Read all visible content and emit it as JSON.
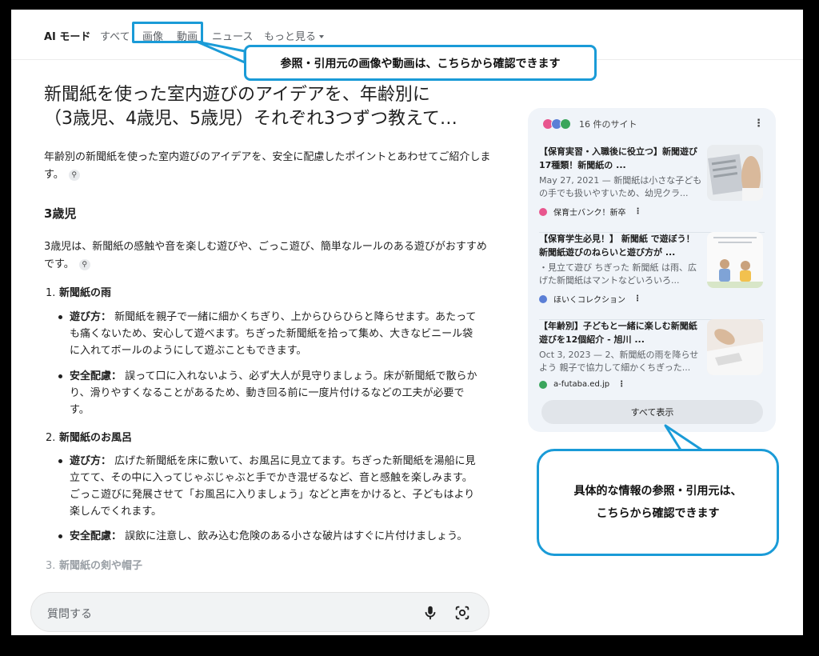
{
  "tabs": {
    "ai_mode": "AI モード",
    "all": "すべて",
    "images": "画像",
    "videos": "動画",
    "news": "ニュース",
    "more": "もっと見る"
  },
  "callouts": {
    "top": "参照・引用元の画像や動画は、こちらから確認できます",
    "bottom_line1": "具体的な情報の参照・引用元は、",
    "bottom_line2": "こちらから確認できます"
  },
  "main": {
    "title_line1": "新聞紙を使った室内遊びのアイデアを、年齢別に",
    "title_line2": "（3歳児、4歳児、5歳児）それぞれ3つずつ教えて…",
    "intro": "年齢別の新聞紙を使った室内遊びのアイデアを、安全に配慮したポイントとあわせてご紹介します。",
    "section_heading": "3歳児",
    "section_intro": "3歳児は、新聞紙の感触や音を楽しむ遊びや、ごっこ遊び、簡単なルールのある遊びがおすすめです。",
    "items": [
      {
        "number": "1.",
        "title": "新聞紙の雨",
        "how_label": "遊び方：",
        "how": "新聞紙を親子で一緒に細かくちぎり、上からひらひらと降らせます。あたっても痛くないため、安心して遊べます。ちぎった新聞紙を拾って集め、大きなビニール袋に入れてボールのようにして遊ぶこともできます。",
        "safety_label": "安全配慮：",
        "safety": "誤って口に入れないよう、必ず大人が見守りましょう。床が新聞紙で散らかり、滑りやすくなることがあるため、動き回る前に一度片付けるなどの工夫が必要です。"
      },
      {
        "number": "2.",
        "title": "新聞紙のお風呂",
        "how_label": "遊び方：",
        "how": "広げた新聞紙を床に敷いて、お風呂に見立てます。ちぎった新聞紙を湯船に見立てて、その中に入ってじゃぶじゃぶと手でかき混ぜるなど、音と感触を楽しみます。ごっこ遊びに発展させて「お風呂に入りましょう」などと声をかけると、子どもはより楽しんでくれます。",
        "safety_label": "安全配慮：",
        "safety": "誤飲に注意し、飲み込む危険のある小さな破片はすぐに片付けましょう。"
      },
      {
        "number": "3.",
        "title": "新聞紙の剣や帽子"
      }
    ]
  },
  "input": {
    "placeholder": "質問する"
  },
  "sidebar": {
    "count": "16 件のサイト",
    "cards": [
      {
        "title": "【保育実習・入職後に役立つ】新聞遊び17種類！新聞紙の ...",
        "snippet": "May 27, 2021 — 新聞紙は小さな子どもの手でも扱いやすいため、幼児クラ...",
        "source": "保育士バンク！新卒",
        "source_color": "#e8568e"
      },
      {
        "title": "【保育学生必見！】 新聞紙 で遊ぼう！新聞紙遊びのねらいと遊び方が ...",
        "snippet": "・見立て遊び ちぎった 新聞紙 は雨、広げた新聞紙はマントなどいろいろ...",
        "source": "ほいくコレクション",
        "source_color": "#5b7fd6"
      },
      {
        "title": "【年齢別】子どもと一緒に楽しむ新聞紙遊びを12個紹介 - 旭川 ...",
        "snippet": "Oct 3, 2023 — 2、新聞紙の雨を降らせよう 親子で協力して細かくちぎった...",
        "source": "a-futaba.ed.jp",
        "source_color": "#3aa55c"
      }
    ],
    "show_all": "すべて表示"
  }
}
